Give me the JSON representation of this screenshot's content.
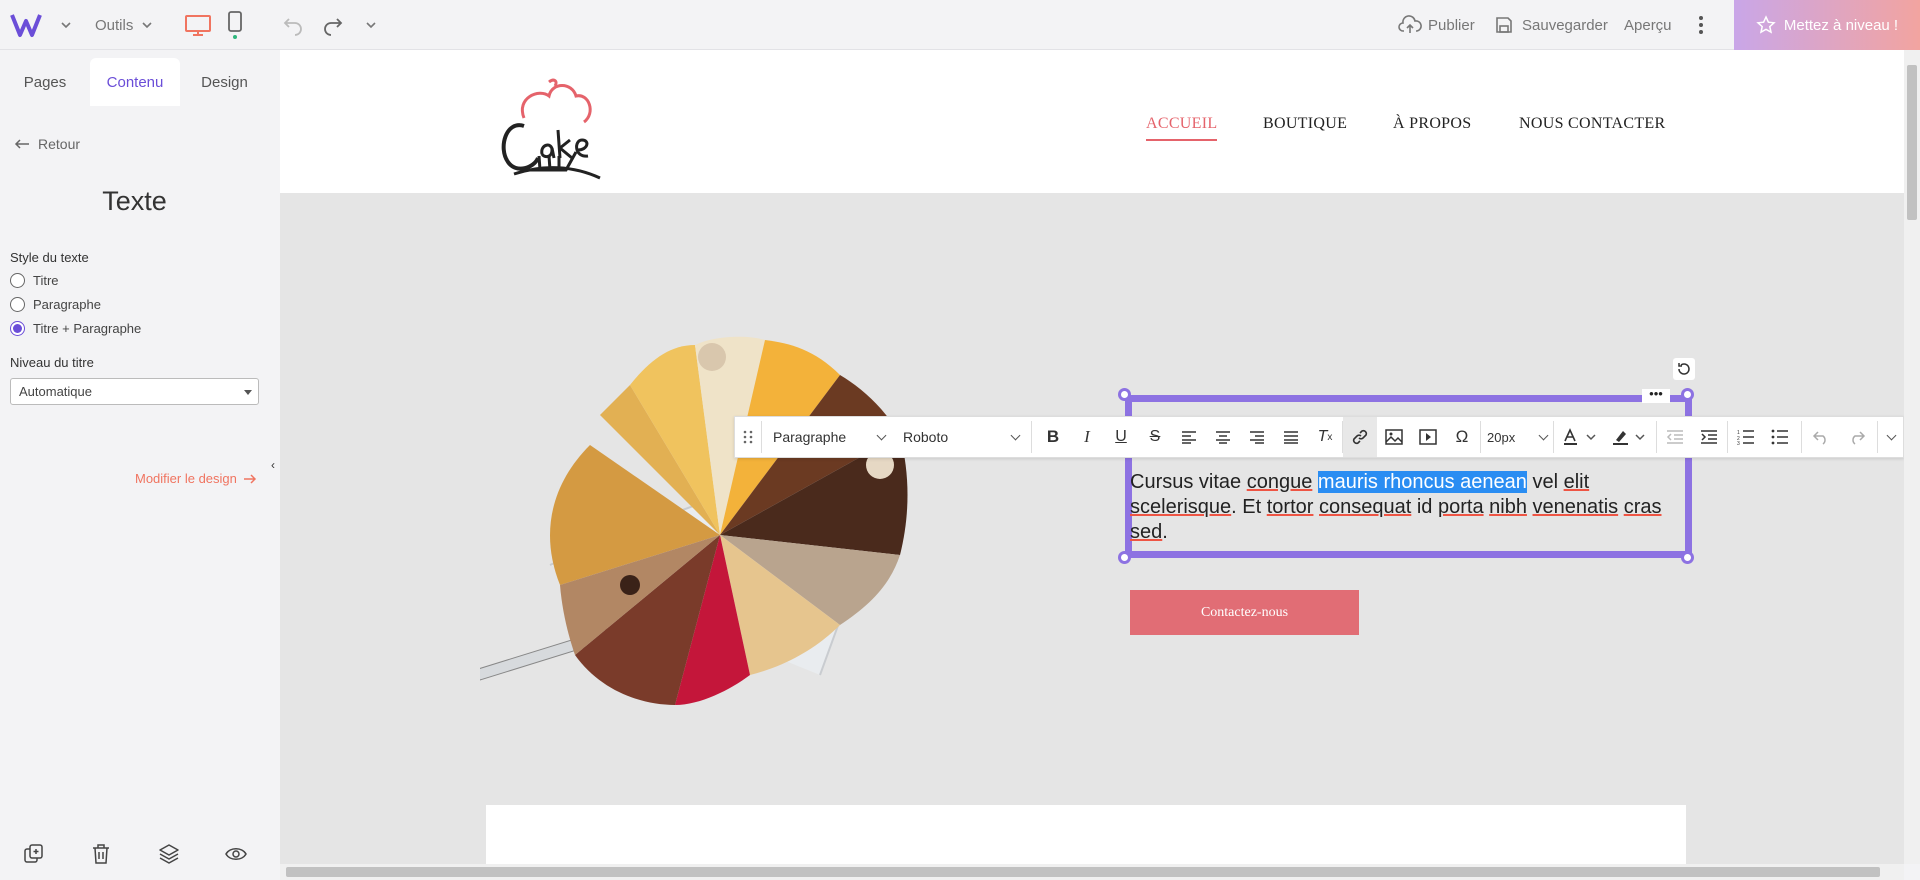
{
  "topbar": {
    "tools_label": "Outils",
    "publish_label": "Publier",
    "save_label": "Sauvegarder",
    "preview_label": "Aperçu",
    "upgrade_label": "Mettez à niveau !"
  },
  "panel": {
    "tabs": [
      "Pages",
      "Contenu",
      "Design"
    ],
    "active_tab": "Contenu",
    "back_label": "Retour",
    "title": "Texte",
    "style_label": "Style du texte",
    "style_options": [
      "Titre",
      "Paragraphe",
      "Titre + Paragraphe"
    ],
    "style_selected": "Titre + Paragraphe",
    "level_label": "Niveau du titre",
    "level_value": "Automatique",
    "modify_design": "Modifier le design"
  },
  "site": {
    "logo_text": "Cake",
    "nav": [
      "ACCUEIL",
      "BOUTIQUE",
      "À PROPOS",
      "NOUS CONTACTER"
    ],
    "nav_active": "ACCUEIL",
    "text_before": "Cursus vitae ",
    "text_u1": "congue",
    "text_sp1": " ",
    "text_selected": "mauris rhoncus aenean",
    "text_sp2": " vel ",
    "text_u2": "elit",
    "text_sp3": " ",
    "text_u3": "scelerisque",
    "text_sp4": ". Et ",
    "text_u4": "tortor",
    "text_sp5": " ",
    "text_u5": "consequat",
    "text_sp6": " id ",
    "text_u6": "porta",
    "text_sp7": " ",
    "text_u7": "nibh",
    "text_sp8": " ",
    "text_u8": "venenatis",
    "text_sp9": " ",
    "text_u9": "cras",
    "text_sp10": " ",
    "text_u10": "sed",
    "text_end": ".",
    "cta_label": "Contactez-nous"
  },
  "toolbar": {
    "format": "Paragraphe",
    "font": "Roboto",
    "size": "20px"
  },
  "colors": {
    "accent": "#6b4ed8",
    "selection": "#8d72e2",
    "brand": "#e5636b",
    "cta": "#e16d75"
  }
}
